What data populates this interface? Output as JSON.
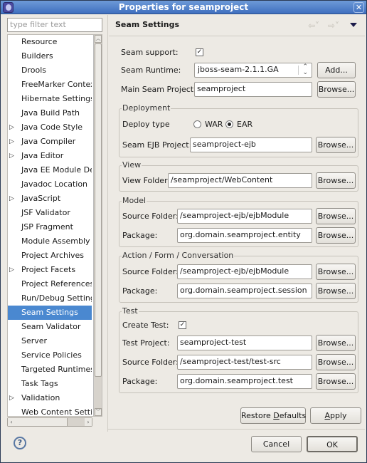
{
  "window": {
    "title": "Properties for seamproject"
  },
  "filter": {
    "placeholder": "type filter text"
  },
  "tree": {
    "items": [
      {
        "label": "Resource",
        "expandable": false
      },
      {
        "label": "Builders",
        "expandable": false
      },
      {
        "label": "Drools",
        "expandable": false
      },
      {
        "label": "FreeMarker Context",
        "expandable": false
      },
      {
        "label": "Hibernate Settings",
        "expandable": false
      },
      {
        "label": "Java Build Path",
        "expandable": false
      },
      {
        "label": "Java Code Style",
        "expandable": true
      },
      {
        "label": "Java Compiler",
        "expandable": true
      },
      {
        "label": "Java Editor",
        "expandable": true
      },
      {
        "label": "Java EE Module Dep",
        "expandable": false
      },
      {
        "label": "Javadoc Location",
        "expandable": false
      },
      {
        "label": "JavaScript",
        "expandable": true
      },
      {
        "label": "JSF Validator",
        "expandable": false
      },
      {
        "label": "JSP Fragment",
        "expandable": false
      },
      {
        "label": "Module Assembly",
        "expandable": false
      },
      {
        "label": "Project Archives",
        "expandable": false
      },
      {
        "label": "Project Facets",
        "expandable": true
      },
      {
        "label": "Project References",
        "expandable": false
      },
      {
        "label": "Run/Debug Settings",
        "expandable": false
      },
      {
        "label": "Seam Settings",
        "expandable": false,
        "selected": true
      },
      {
        "label": "Seam Validator",
        "expandable": false
      },
      {
        "label": "Server",
        "expandable": false
      },
      {
        "label": "Service Policies",
        "expandable": false
      },
      {
        "label": "Targeted Runtimes",
        "expandable": false
      },
      {
        "label": "Task Tags",
        "expandable": false
      },
      {
        "label": "Validation",
        "expandable": true
      },
      {
        "label": "Web Content Settin",
        "expandable": false
      }
    ]
  },
  "page": {
    "title": "Seam Settings",
    "seam_support_label": "Seam support:",
    "seam_support_checked": true,
    "seam_runtime_label": "Seam Runtime:",
    "seam_runtime_value": "jboss-seam-2.1.1.GA",
    "add_label": "Add...",
    "main_project_label": "Main Seam Project:",
    "main_project_value": "seamproject",
    "browse_label": "Browse...",
    "deployment": {
      "title": "Deployment",
      "deploy_type_label": "Deploy type",
      "war_label": "WAR",
      "ear_label": "EAR",
      "selected": "EAR",
      "ejb_project_label": "Seam EJB Project:",
      "ejb_project_value": "seamproject-ejb"
    },
    "view": {
      "title": "View",
      "folder_label": "View Folder:",
      "folder_value": "/seamproject/WebContent"
    },
    "model": {
      "title": "Model",
      "source_label": "Source Folder:",
      "source_value": "/seamproject-ejb/ejbModule",
      "package_label": "Package:",
      "package_value": "org.domain.seamproject.entity"
    },
    "action": {
      "title": "Action / Form / Conversation",
      "source_label": "Source Folder:",
      "source_value": "/seamproject-ejb/ejbModule",
      "package_label": "Package:",
      "package_value": "org.domain.seamproject.session"
    },
    "test": {
      "title": "Test",
      "create_label": "Create Test:",
      "create_checked": true,
      "project_label": "Test Project:",
      "project_value": "seamproject-test",
      "source_label": "Source Folder:",
      "source_value": "/seamproject-test/test-src",
      "package_label": "Package:",
      "package_value": "org.domain.seamproject.test"
    },
    "restore_pre": "Restore ",
    "restore_mn": "D",
    "restore_post": "efaults",
    "apply_mn": "A",
    "apply_post": "pply"
  },
  "footer": {
    "cancel_label": "Cancel",
    "ok_label": "OK"
  }
}
